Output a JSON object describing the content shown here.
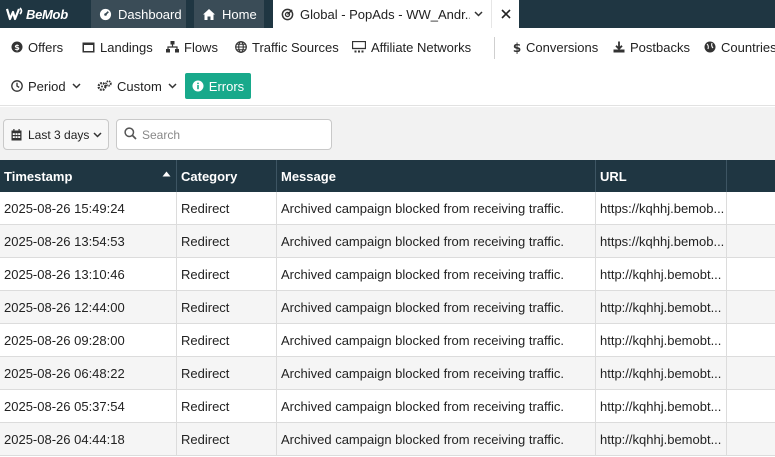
{
  "app": {
    "logo_text": "BeMob"
  },
  "top_tabs": {
    "dashboard": "Dashboard",
    "home": "Home",
    "campaign": "Global - PopAds - WW_Andr..."
  },
  "nav": {
    "offers": "Offers",
    "landings": "Landings",
    "flows": "Flows",
    "traffic_sources": "Traffic Sources",
    "affiliate_networks": "Affiliate Networks",
    "conversions": "Conversions",
    "postbacks": "Postbacks",
    "countries": "Countries"
  },
  "filters": {
    "period": "Period",
    "custom": "Custom",
    "errors": "Errors"
  },
  "toolbar": {
    "date_range": "Last 3 days",
    "search_placeholder": "Search"
  },
  "table": {
    "headers": [
      "Timestamp",
      "Category",
      "Message",
      "URL"
    ],
    "rows": [
      {
        "timestamp": "2025-08-26 15:49:24",
        "category": "Redirect",
        "message": "Archived campaign blocked from receiving traffic.",
        "url": "https://kqhhj.bemob..."
      },
      {
        "timestamp": "2025-08-26 13:54:53",
        "category": "Redirect",
        "message": "Archived campaign blocked from receiving traffic.",
        "url": "https://kqhhj.bemob..."
      },
      {
        "timestamp": "2025-08-26 13:10:46",
        "category": "Redirect",
        "message": "Archived campaign blocked from receiving traffic.",
        "url": "http://kqhhj.bemobt..."
      },
      {
        "timestamp": "2025-08-26 12:44:00",
        "category": "Redirect",
        "message": "Archived campaign blocked from receiving traffic.",
        "url": "http://kqhhj.bemobt..."
      },
      {
        "timestamp": "2025-08-26 09:28:00",
        "category": "Redirect",
        "message": "Archived campaign blocked from receiving traffic.",
        "url": "http://kqhhj.bemobt..."
      },
      {
        "timestamp": "2025-08-26 06:48:22",
        "category": "Redirect",
        "message": "Archived campaign blocked from receiving traffic.",
        "url": "http://kqhhj.bemobt..."
      },
      {
        "timestamp": "2025-08-26 05:37:54",
        "category": "Redirect",
        "message": "Archived campaign blocked from receiving traffic.",
        "url": "http://kqhhj.bemobt..."
      },
      {
        "timestamp": "2025-08-26 04:44:18",
        "category": "Redirect",
        "message": "Archived campaign blocked from receiving traffic.",
        "url": "http://kqhhj.bemobt..."
      }
    ]
  },
  "colors": {
    "topbar_bg": "#1f3642",
    "table_header_bg": "#1f3642",
    "errors_accent": "#18a98b"
  },
  "icons": {
    "logo": "bemob-logo-icon",
    "dashboard": "dashboard-gauge-icon",
    "home": "home-icon",
    "campaign": "campaign-globe-icon",
    "offers": "dollar-circle-icon",
    "landings": "window-icon",
    "flows": "sitemap-icon",
    "traffic_sources": "globe-icon",
    "affiliate_networks": "network-icon",
    "conversions": "dollar-icon",
    "postbacks": "download-icon",
    "countries": "globe-icon",
    "period": "clock-icon",
    "custom": "gears-icon",
    "errors": "info-circle-icon",
    "date": "calendar-icon",
    "search": "search-icon"
  }
}
